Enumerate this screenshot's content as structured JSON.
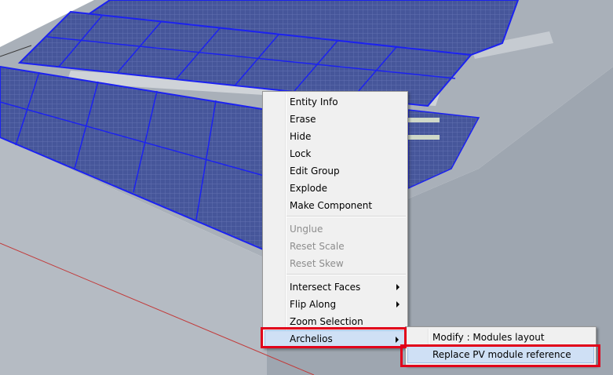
{
  "context_menu": {
    "items": [
      {
        "label": "Entity Info"
      },
      {
        "label": "Erase"
      },
      {
        "label": "Hide"
      },
      {
        "label": "Lock"
      },
      {
        "label": "Edit Group"
      },
      {
        "label": "Explode"
      },
      {
        "label": "Make Component"
      },
      {
        "label": "Unglue",
        "disabled": true
      },
      {
        "label": "Reset Scale",
        "disabled": true
      },
      {
        "label": "Reset Skew",
        "disabled": true
      },
      {
        "label": "Intersect Faces",
        "submenu": true
      },
      {
        "label": "Flip Along",
        "submenu": true
      },
      {
        "label": "Zoom Selection"
      },
      {
        "label": "Archelios",
        "submenu": true,
        "highlighted": true
      }
    ]
  },
  "submenu": {
    "items": [
      {
        "label": "Modify : Modules layout"
      },
      {
        "label": "Replace PV module reference",
        "highlighted": true
      }
    ]
  },
  "colors": {
    "panel_fill": "#3f4e8c",
    "panel_frame": "#1c22f0",
    "ground": "#a4acb6",
    "highlight_box": "#e1001a"
  }
}
